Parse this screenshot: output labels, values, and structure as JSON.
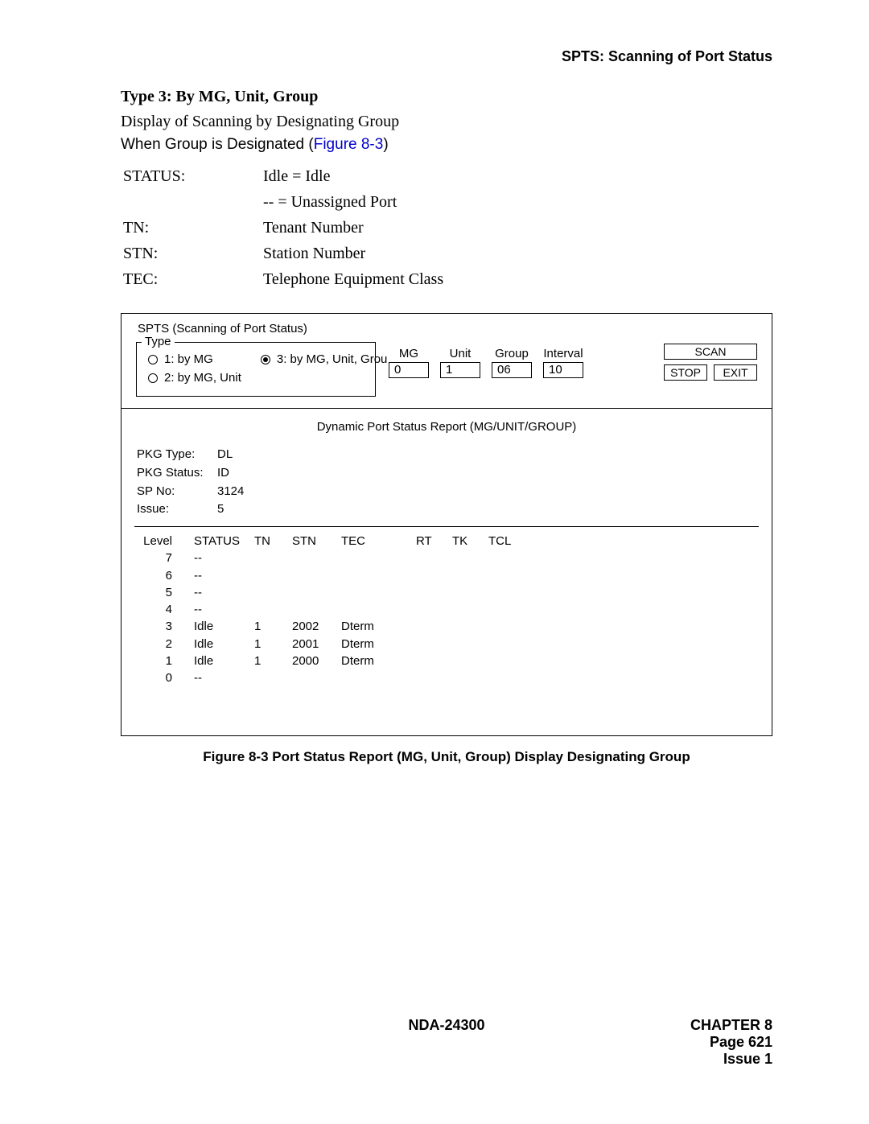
{
  "header": {
    "right_title": "SPTS:  Scanning of Port Status"
  },
  "section": {
    "title": "Type 3: By MG, Unit, Group",
    "line1": "Display of Scanning by Designating Group",
    "line2a": "When Group is Designated (",
    "line2_link": "Figure 8-3",
    "line2b": ")",
    "defs": [
      {
        "label": "STATUS:",
        "value": "Idle = Idle"
      },
      {
        "label": "",
        "value": "-- = Unassigned Port"
      },
      {
        "label": "TN:",
        "value": "Tenant Number"
      },
      {
        "label": "STN:",
        "value": "Station Number"
      },
      {
        "label": "TEC:",
        "value": "Telephone Equipment Class"
      }
    ]
  },
  "shot": {
    "window_title": "SPTS (Scanning of Port Status)",
    "type_legend": "Type",
    "type_options": {
      "opt1": "1: by MG",
      "opt2": "2: by MG, Unit",
      "opt3": "3: by MG, Unit, Grou"
    },
    "selected_index": 3,
    "fields": {
      "mg_label": "MG",
      "mg_value": "0",
      "unit_label": "Unit",
      "unit_value": "1",
      "group_label": "Group",
      "group_value": "06",
      "interval_label": "Interval",
      "interval_value": "10"
    },
    "buttons": {
      "scan": "SCAN",
      "stop": "STOP",
      "exit": "EXIT"
    },
    "report": {
      "title": "Dynamic Port Status Report (MG/UNIT/GROUP)",
      "pkg_type_label": "PKG Type:",
      "pkg_type_value": "DL",
      "pkg_status_label": "PKG Status:",
      "pkg_status_value": "ID",
      "sp_no_label": "SP No:",
      "sp_no_value": "3124",
      "issue_label": "Issue:",
      "issue_value": "5",
      "cols": {
        "level": "Level",
        "status": "STATUS",
        "tn": "TN",
        "stn": "STN",
        "tec": "TEC",
        "rt": "RT",
        "tk": "TK",
        "tcl": "TCL"
      },
      "rows": [
        {
          "level": "7",
          "status": "--",
          "tn": "",
          "stn": "",
          "tec": ""
        },
        {
          "level": "6",
          "status": "--",
          "tn": "",
          "stn": "",
          "tec": ""
        },
        {
          "level": "5",
          "status": "--",
          "tn": "",
          "stn": "",
          "tec": ""
        },
        {
          "level": "4",
          "status": "--",
          "tn": "",
          "stn": "",
          "tec": ""
        },
        {
          "level": "3",
          "status": "Idle",
          "tn": "1",
          "stn": "2002",
          "tec": "Dterm"
        },
        {
          "level": "2",
          "status": "Idle",
          "tn": "1",
          "stn": "2001",
          "tec": "Dterm"
        },
        {
          "level": "1",
          "status": "Idle",
          "tn": "1",
          "stn": "2000",
          "tec": "Dterm"
        },
        {
          "level": "0",
          "status": "--",
          "tn": "",
          "stn": "",
          "tec": ""
        }
      ]
    }
  },
  "figure_caption": "Figure 8-3   Port Status Report (MG, Unit, Group) Display    Designating Group",
  "footer": {
    "center": "NDA-24300",
    "chapter": "CHAPTER 8",
    "page": "Page 621",
    "issue": "Issue 1"
  }
}
